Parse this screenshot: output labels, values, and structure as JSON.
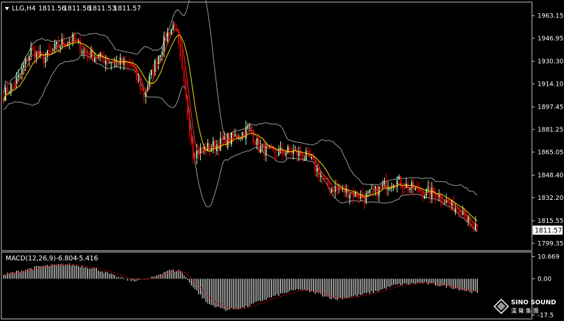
{
  "header": {
    "symbol": "LLG,H4",
    "ohlc": [
      "1811.56",
      "1811.58",
      "1811.53",
      "1811.57"
    ]
  },
  "macd_header": {
    "label": "MACD(12,26,9)",
    "values": [
      "-6.804",
      "-5.416"
    ]
  },
  "colors": {
    "background": "#000000",
    "frame": "#c8c8c8",
    "bull": "#b8f2b8",
    "bear": "#e60000",
    "bands": "#9a9a9a",
    "ma_fast": "#ff2a2a",
    "ma_slow": "#f3e000",
    "macd_hist": "#ffffff",
    "macd_signal": "#e00000",
    "price_tag_bg": "#ffffff",
    "price_tag_text": "#000000",
    "text": "#ffffff"
  },
  "watermark": {
    "brand": "SINO SOUND",
    "brand_cn": "漢 聲 集 團"
  },
  "chart_data": [
    {
      "type": "candlestick",
      "title": "LLG,H4",
      "last_price": 1811.57,
      "ylim": [
        1795,
        1972
      ],
      "y_ticks": [
        "1963.15",
        "1946.95",
        "1930.30",
        "1914.10",
        "1897.45",
        "1881.25",
        "1865.05",
        "1848.40",
        "1832.20",
        "1815.55",
        "1799.35"
      ],
      "key_closes": [
        [
          0,
          1906
        ],
        [
          8,
          1918
        ],
        [
          15,
          1938
        ],
        [
          22,
          1932
        ],
        [
          30,
          1942
        ],
        [
          38,
          1946
        ],
        [
          45,
          1936
        ],
        [
          55,
          1932
        ],
        [
          62,
          1930
        ],
        [
          70,
          1927
        ],
        [
          77,
          1906
        ],
        [
          84,
          1932
        ],
        [
          90,
          1950
        ],
        [
          94,
          1958
        ],
        [
          99,
          1912
        ],
        [
          104,
          1864
        ],
        [
          112,
          1868
        ],
        [
          120,
          1872
        ],
        [
          130,
          1878
        ],
        [
          135,
          1882
        ],
        [
          140,
          1868
        ],
        [
          148,
          1864
        ],
        [
          158,
          1866
        ],
        [
          168,
          1860
        ],
        [
          178,
          1840
        ],
        [
          190,
          1836
        ],
        [
          198,
          1832
        ],
        [
          206,
          1838
        ],
        [
          214,
          1845
        ],
        [
          222,
          1840
        ],
        [
          230,
          1836
        ],
        [
          238,
          1835
        ],
        [
          246,
          1826
        ],
        [
          252,
          1824
        ],
        [
          257,
          1809
        ],
        [
          260,
          1811.57
        ]
      ],
      "overlays": [
        "Bollinger Bands",
        "Moving Average (fast)",
        "Moving Average (slow)"
      ]
    },
    {
      "type": "bar",
      "title": "MACD(12,26,9)",
      "ylim": [
        -19,
        12.5
      ],
      "y_ticks": [
        "10.669",
        "0.00",
        "-17.5"
      ],
      "series": [
        {
          "name": "MACD",
          "key_values": [
            [
              0,
              2
            ],
            [
              20,
              6
            ],
            [
              35,
              7
            ],
            [
              50,
              5
            ],
            [
              62,
              1
            ],
            [
              70,
              -1
            ],
            [
              80,
              0
            ],
            [
              90,
              4
            ],
            [
              97,
              4
            ],
            [
              104,
              -4
            ],
            [
              112,
              -12
            ],
            [
              122,
              -15
            ],
            [
              132,
              -14
            ],
            [
              140,
              -11
            ],
            [
              150,
              -8
            ],
            [
              162,
              -5
            ],
            [
              172,
              -7
            ],
            [
              182,
              -10
            ],
            [
              195,
              -8
            ],
            [
              205,
              -6
            ],
            [
              215,
              -3
            ],
            [
              230,
              -2
            ],
            [
              245,
              -4
            ],
            [
              255,
              -6
            ],
            [
              260,
              -6.804
            ]
          ]
        },
        {
          "name": "Signal",
          "last": -5.416
        }
      ]
    }
  ]
}
